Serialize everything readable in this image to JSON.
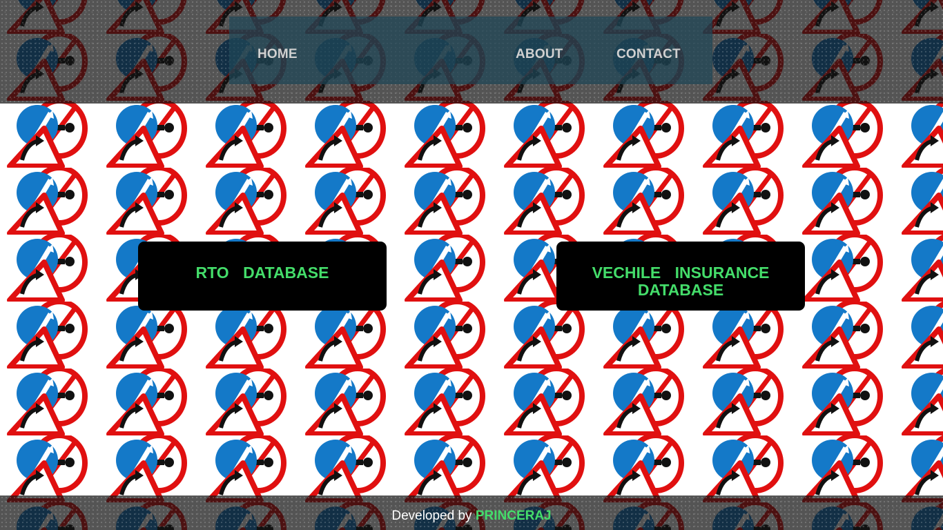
{
  "nav": {
    "home": "HOME",
    "about": "ABOUT",
    "contact": "CONTACT"
  },
  "cards": {
    "rto": "RTO DATABASE",
    "insurance": "VECHILE INSURANCE DATABASE"
  },
  "footer": {
    "prefix": "Developed by",
    "author": "PRINCERAJ"
  },
  "background": {
    "pattern_icon": "traffic-sign-cluster-icon"
  },
  "colors": {
    "accent_green": "#44dd6a",
    "sign_red": "#e01010",
    "sign_blue": "#1479c8",
    "card_black": "#000000"
  }
}
